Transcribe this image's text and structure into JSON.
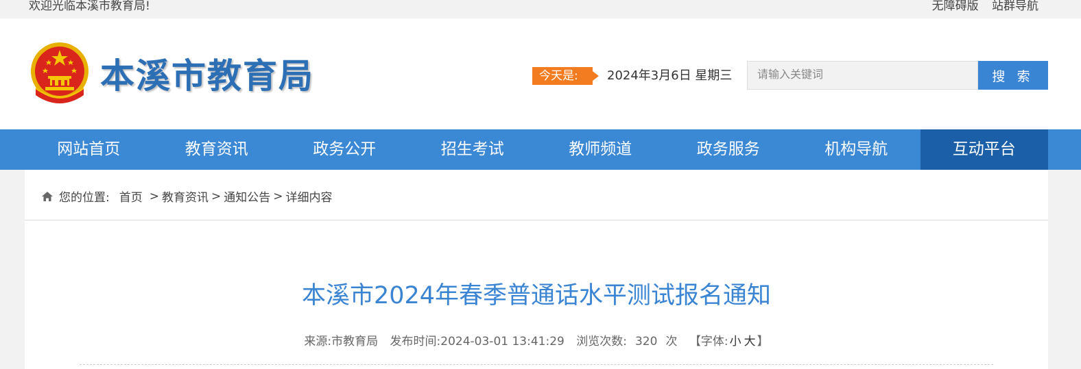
{
  "topbar": {
    "welcome": "欢迎光临本溪市教育局!",
    "accessible": "无障碍版",
    "site_group": "站群导航"
  },
  "header": {
    "site_name": "本溪市教育局",
    "today_label": "今天是:",
    "today_date": "2024年3月6日 星期三",
    "search_placeholder": "请输入关键词",
    "search_button": "搜 索"
  },
  "nav": {
    "items": [
      {
        "label": "网站首页"
      },
      {
        "label": "教育资讯"
      },
      {
        "label": "政务公开"
      },
      {
        "label": "招生考试"
      },
      {
        "label": "教师频道"
      },
      {
        "label": "政务服务"
      },
      {
        "label": "机构导航"
      },
      {
        "label": "互动平台"
      }
    ],
    "active_index": 7
  },
  "breadcrumb": {
    "prefix": "您的位置:",
    "items": [
      "首页",
      "教育资讯",
      "通知公告",
      "详细内容"
    ],
    "separator": ">"
  },
  "article": {
    "title": "本溪市2024年春季普通话水平测试报名通知",
    "source_label": "来源:",
    "source": "市教育局",
    "time_label": "发布时间:",
    "time": "2024-03-01 13:41:29",
    "views_label": "浏览次数:",
    "views": "320",
    "views_unit": "次",
    "font_label": "【字体:",
    "font_small": "小",
    "font_large": "大",
    "font_close": "】"
  },
  "colors": {
    "nav_bg": "#3b88d5",
    "nav_active": "#1a5fa8",
    "title": "#3a84d4",
    "today_tag": "#f47c20",
    "search_button": "#3a84d4"
  },
  "icons": {
    "emblem": "national-emblem-icon",
    "home": "home-icon"
  }
}
